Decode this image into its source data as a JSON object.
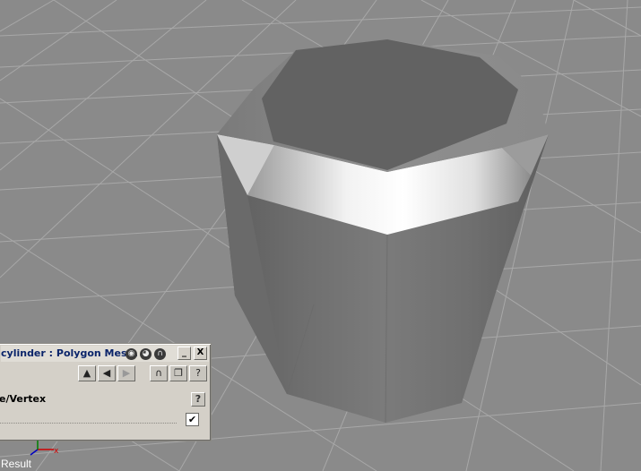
{
  "viewport": {
    "object": "cylinder",
    "status_label": "Result"
  },
  "panel": {
    "title": "cylinder : Polygon Mes...",
    "title_icons": [
      "eye-icon",
      "sphere-icon",
      "lock-icon"
    ],
    "window_buttons": {
      "minimize": "_",
      "close": "X"
    },
    "toolbar": {
      "up": "▲",
      "back": "◀",
      "forward": "▶",
      "magnet": "∩",
      "page": "❐",
      "help": "?"
    },
    "section_label": "e/Vertex",
    "help": "?",
    "checkbox_mark": "✔",
    "checked": true
  },
  "colors": {
    "background": "#8a8a8a",
    "grid_line": "#a3a3a3",
    "panel_bg": "#d4d0c8",
    "title_text": "#0a246a"
  }
}
